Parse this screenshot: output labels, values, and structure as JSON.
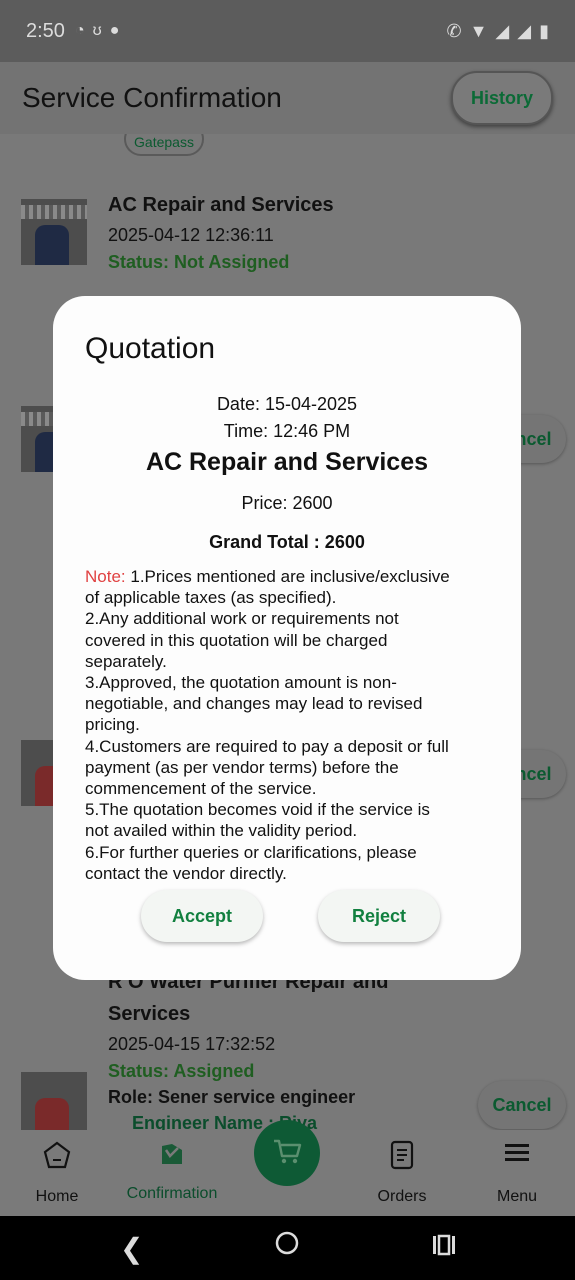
{
  "status_bar": {
    "time": "2:50"
  },
  "app_bar": {
    "title": "Service Confirmation",
    "history_label": "History"
  },
  "background": {
    "gatepass_label": "Gatepass",
    "cards": [
      {
        "title": "AC Repair and Services",
        "datetime": "2025-04-12 12:36:11",
        "status": "Status: Not Assigned"
      },
      {
        "cancel_label": "Cancel"
      },
      {
        "cancel_label": "Cancel"
      },
      {
        "title_line1": "R O Water Purifier Repair and",
        "title_line2": "Services",
        "datetime": "2025-04-15 17:32:52",
        "status": "Status: Assigned",
        "role": "Role: Sener service engineer",
        "engineer": "Engineer Name : Riya",
        "cancel_label": "Cancel"
      }
    ]
  },
  "modal": {
    "title": "Quotation",
    "date": "Date: 15-04-2025",
    "time": "Time: 12:46 PM",
    "service": "AC Repair and Services",
    "price": "Price: 2600",
    "grand_total": "Grand Total : 2600",
    "note_label": "Note:",
    "note_lines": [
      " 1.Prices mentioned are inclusive/exclusive",
      "of applicable taxes (as specified).",
      "2.Any additional work or requirements not",
      "covered in this quotation will be charged",
      "separately.",
      "3.Approved, the quotation amount is non-",
      "negotiable, and changes may lead to revised",
      "pricing.",
      "4.Customers are required to pay a deposit or full",
      "payment (as per vendor terms) before the",
      "commencement of the service.",
      "5.The quotation becomes void if the service is",
      "not availed within the validity period.",
      "6.For further queries or clarifications, please",
      "contact the vendor directly."
    ],
    "accept_label": "Accept",
    "reject_label": "Reject"
  },
  "bottom_nav": {
    "items": [
      {
        "label": "Home"
      },
      {
        "label": "Confirmation"
      },
      {
        "label": "Orders"
      },
      {
        "label": "Menu"
      }
    ]
  },
  "colors": {
    "accent_green": "#11803f",
    "note_red": "#e04242",
    "fab_green": "#0e5a35"
  }
}
